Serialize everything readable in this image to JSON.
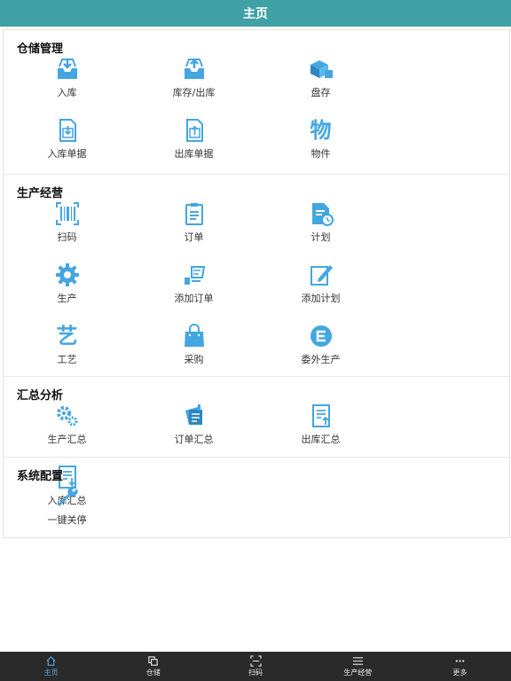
{
  "header": {
    "title": "主页"
  },
  "sections": [
    {
      "title": "仓储管理",
      "items": [
        {
          "label": "入库",
          "icon": "inbox-in-icon"
        },
        {
          "label": "库存/出库",
          "icon": "inbox-out-icon"
        },
        {
          "label": "盘存",
          "icon": "boxes-icon"
        },
        {
          "label": "入库单据",
          "icon": "doc-in-icon"
        },
        {
          "label": "出库单据",
          "icon": "doc-out-icon"
        },
        {
          "label": "物件",
          "icon": "wu-character-icon",
          "glyph": "物"
        }
      ]
    },
    {
      "title": "生产经营",
      "items": [
        {
          "label": "扫码",
          "icon": "barcode-scan-icon"
        },
        {
          "label": "订单",
          "icon": "clipboard-icon"
        },
        {
          "label": "计划",
          "icon": "doc-clock-icon"
        },
        {
          "label": "生产",
          "icon": "gear-icon"
        },
        {
          "label": "添加订单",
          "icon": "add-order-icon"
        },
        {
          "label": "添加计划",
          "icon": "edit-plan-icon"
        },
        {
          "label": "工艺",
          "icon": "yi-character-icon",
          "glyph": "艺"
        },
        {
          "label": "采购",
          "icon": "shopping-bag-icon"
        },
        {
          "label": "委外生产",
          "icon": "e-circle-icon"
        }
      ]
    },
    {
      "title": "汇总分析",
      "items": [
        {
          "label": "生产汇总",
          "icon": "gears-icon"
        },
        {
          "label": "订单汇总",
          "icon": "orders-stack-icon"
        },
        {
          "label": "出库汇总",
          "icon": "report-out-icon"
        },
        {
          "label": "入库汇总",
          "icon": "report-in-icon"
        }
      ]
    },
    {
      "title": "系统配置",
      "items": [
        {
          "label": "一键关停",
          "icon": "wrench-icon"
        }
      ]
    }
  ],
  "tabs": [
    {
      "label": "主页",
      "icon": "home-icon",
      "active": true
    },
    {
      "label": "仓储",
      "icon": "warehouse-icon",
      "active": false
    },
    {
      "label": "扫码",
      "icon": "scan-icon",
      "active": false
    },
    {
      "label": "生产经营",
      "icon": "menu-icon",
      "active": false
    },
    {
      "label": "更多",
      "icon": "more-icon",
      "active": false
    }
  ],
  "colors": {
    "header": "#3fa0a6",
    "icon": "#44a6e0",
    "tabbar": "#2a2a2a",
    "tab_active": "#5aa8e8"
  }
}
